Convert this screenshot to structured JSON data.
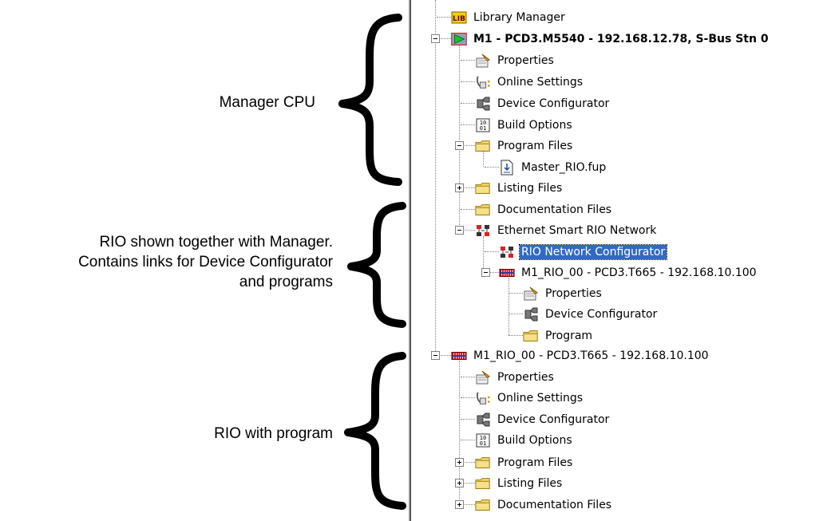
{
  "annotations": {
    "manager": {
      "lines": [
        "Manager CPU"
      ]
    },
    "rio": {
      "lines": [
        "RIO shown together with Manager.",
        "Contains links for Device Configurator",
        "and programs"
      ]
    },
    "program": {
      "lines": [
        "RIO with program"
      ]
    }
  },
  "tree": {
    "nodes": [
      {
        "id": "library-manager",
        "label": "Library Manager",
        "icon": "lib-icon"
      },
      {
        "id": "m1-cpu",
        "label": "M1 - PCD3.M5540 - 192.168.12.78, S-Bus Stn 0",
        "icon": "cpu-play-icon",
        "bold": true,
        "expander": "minus"
      },
      {
        "id": "m1-properties",
        "label": "Properties",
        "icon": "properties-icon"
      },
      {
        "id": "m1-online-settings",
        "label": "Online Settings",
        "icon": "online-settings-icon"
      },
      {
        "id": "m1-device-configurator",
        "label": "Device Configurator",
        "icon": "device-configurator-icon"
      },
      {
        "id": "m1-build-options",
        "label": "Build Options",
        "icon": "build-options-icon"
      },
      {
        "id": "m1-program-files",
        "label": "Program Files",
        "icon": "folder-icon",
        "expander": "minus"
      },
      {
        "id": "master-rio-fup",
        "label": "Master_RIO.fup",
        "icon": "fup-file-icon"
      },
      {
        "id": "m1-listing-files",
        "label": "Listing Files",
        "icon": "folder-icon",
        "expander": "plus"
      },
      {
        "id": "m1-documentation-files",
        "label": "Documentation Files",
        "icon": "folder-icon"
      },
      {
        "id": "ethernet-smart-rio-network",
        "label": "Ethernet Smart RIO Network",
        "icon": "network-icon",
        "expander": "minus"
      },
      {
        "id": "rio-network-configurator",
        "label": "RIO Network Configurator",
        "icon": "network-icon",
        "selected": true
      },
      {
        "id": "m1-rio-00-linked",
        "label": "M1_RIO_00 - PCD3.T665 - 192.168.10.100",
        "icon": "rio-module-icon",
        "expander": "minus"
      },
      {
        "id": "rio-linked-properties",
        "label": "Properties",
        "icon": "properties-icon"
      },
      {
        "id": "rio-linked-device-configurator",
        "label": "Device Configurator",
        "icon": "device-configurator-icon"
      },
      {
        "id": "rio-linked-program",
        "label": "Program",
        "icon": "folder-icon"
      },
      {
        "id": "m1-rio-00",
        "label": "M1_RIO_00 - PCD3.T665 - 192.168.10.100",
        "icon": "rio-module-icon",
        "expander": "minus"
      },
      {
        "id": "rio-properties",
        "label": "Properties",
        "icon": "properties-icon"
      },
      {
        "id": "rio-online-settings",
        "label": "Online Settings",
        "icon": "online-settings-icon"
      },
      {
        "id": "rio-device-configurator",
        "label": "Device Configurator",
        "icon": "device-configurator-icon"
      },
      {
        "id": "rio-build-options",
        "label": "Build Options",
        "icon": "build-options-icon"
      },
      {
        "id": "rio-program-files",
        "label": "Program Files",
        "icon": "folder-icon",
        "expander": "plus"
      },
      {
        "id": "rio-listing-files",
        "label": "Listing Files",
        "icon": "folder-icon",
        "expander": "plus"
      },
      {
        "id": "rio-documentation-files",
        "label": "Documentation Files",
        "icon": "folder-icon",
        "expander": "plus"
      }
    ]
  },
  "colors": {
    "selection": "#316ac5",
    "folder": "#f2d66a",
    "network": "#e02020",
    "rio_module": "#c01010",
    "cpu_play": "#22c022"
  }
}
